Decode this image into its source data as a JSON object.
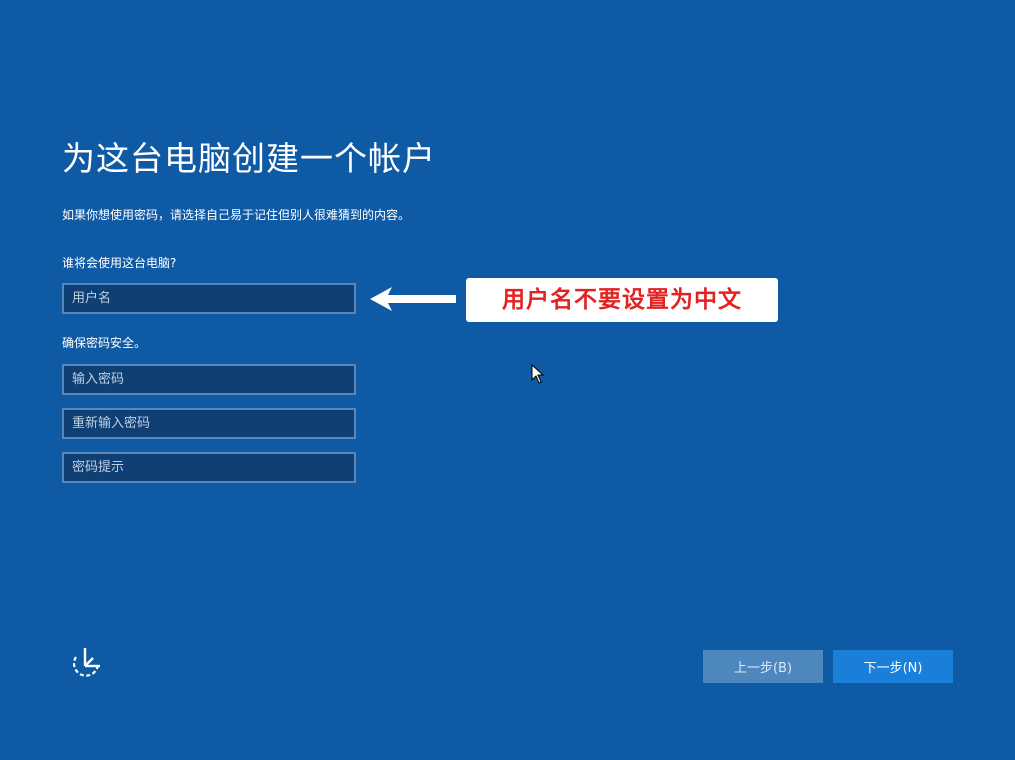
{
  "page": {
    "title": "为这台电脑创建一个帐户",
    "subtitle": "如果你想使用密码，请选择自己易于记住但别人很难猜到的内容。"
  },
  "form": {
    "user_label": "谁将会使用这台电脑?",
    "username_placeholder": "用户名",
    "password_section_label": "确保密码安全。",
    "password_placeholder": "输入密码",
    "reenter_placeholder": "重新输入密码",
    "hint_placeholder": "密码提示"
  },
  "annotation": {
    "text": "用户名不要设置为中文",
    "text_color": "#e32222"
  },
  "footer": {
    "accessibility_icon": "ease-of-access-icon",
    "back_label": "上一步(B)",
    "next_label": "下一步(N)"
  },
  "colors": {
    "background": "#0f5aa4",
    "field_background": "#103f73",
    "back_button": "#4d87be",
    "next_button": "#1a7fd9"
  }
}
